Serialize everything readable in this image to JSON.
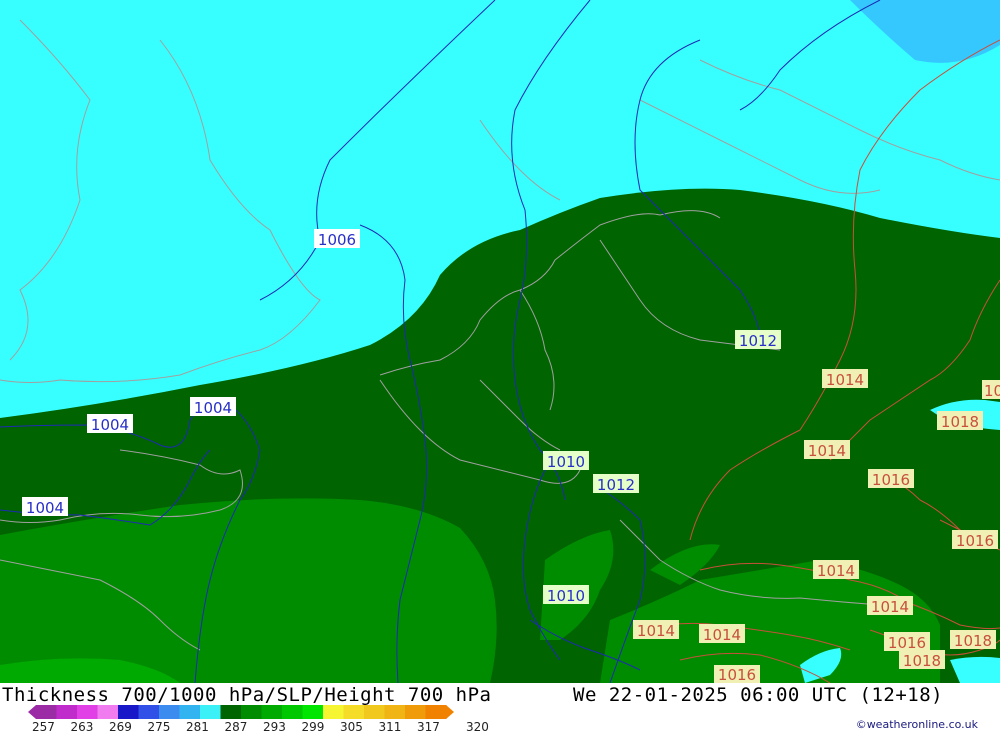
{
  "title": {
    "left": "Thickness 700/1000 hPa/SLP/Height 700 hPa",
    "right": "We 22-01-2025 06:00 UTC (12+18)"
  },
  "credit": "©weatheronline.co.uk",
  "scale": {
    "ticks": [
      "257",
      "263",
      "269",
      "275",
      "281",
      "287",
      "293",
      "299",
      "305",
      "311",
      "317",
      "320"
    ],
    "colors": [
      "#9c2ba6",
      "#c02ccc",
      "#e040e6",
      "#f07cf0",
      "#1818c8",
      "#3050e8",
      "#3c8cf0",
      "#32b4f0",
      "#3cf0f8",
      "#006400",
      "#008c00",
      "#00aa00",
      "#00c800",
      "#00e600",
      "#f5f532",
      "#f5dc28",
      "#f0c81e",
      "#f0b414",
      "#f09c0a",
      "#f08200"
    ]
  },
  "isobars": {
    "blue_labels": [
      "1006",
      "1004",
      "1004",
      "1004",
      "1012",
      "1010",
      "1012",
      "1010"
    ],
    "red_labels": [
      "1014",
      "1014",
      "1018",
      "1016",
      "1016",
      "1014",
      "1014",
      "1014",
      "1014",
      "1016",
      "1018",
      "1016",
      "1018"
    ],
    "cut_label": "10"
  },
  "colors": {
    "cold_cyan": "#38ffff",
    "light_blue": "#34c8ff",
    "dark_green": "#006400",
    "mid_green": "#008c00",
    "bright_green": "#00aa00",
    "isobar_blue": "#1e2ab4",
    "isobar_red": "#c8503c",
    "coast_grey": "#a0a0a0"
  }
}
